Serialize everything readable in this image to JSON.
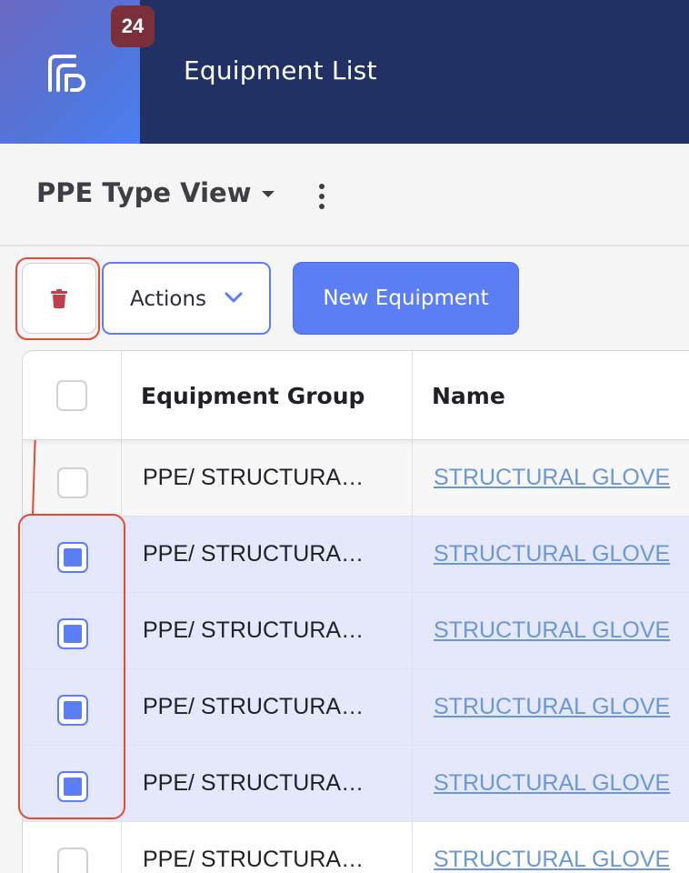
{
  "header": {
    "badge_count": "24",
    "title": "Equipment List",
    "logo_icon": "app-logo-icon",
    "colors": {
      "bar": "#213163",
      "badge": "#7a2f3b"
    }
  },
  "view": {
    "name": "PPE Type View",
    "dropdown_icon": "caret-down-icon",
    "more_icon": "more-vertical-icon"
  },
  "toolbar": {
    "delete_icon": "trash-icon",
    "actions_label": "Actions",
    "actions_icon": "chevron-down-icon",
    "new_label": "New Equipment",
    "accent": "#5b7ef5"
  },
  "table": {
    "columns": [
      "Equipment Group",
      "Name"
    ],
    "rows": [
      {
        "group": "PPE/ STRUCTURA…",
        "name": "STRUCTURAL GLOVE",
        "checked": false
      },
      {
        "group": "PPE/ STRUCTURA…",
        "name": "STRUCTURAL GLOVE",
        "checked": true
      },
      {
        "group": "PPE/ STRUCTURA…",
        "name": "STRUCTURAL GLOVE",
        "checked": true
      },
      {
        "group": "PPE/ STRUCTURA…",
        "name": "STRUCTURAL GLOVE",
        "checked": true
      },
      {
        "group": "PPE/ STRUCTURA…",
        "name": "STRUCTURAL GLOVE",
        "checked": true
      },
      {
        "group": "PPE/ STRUCTURA…",
        "name": "STRUCTURAL GLOVE",
        "checked": false
      }
    ]
  },
  "annotation_color": "#e24a38"
}
